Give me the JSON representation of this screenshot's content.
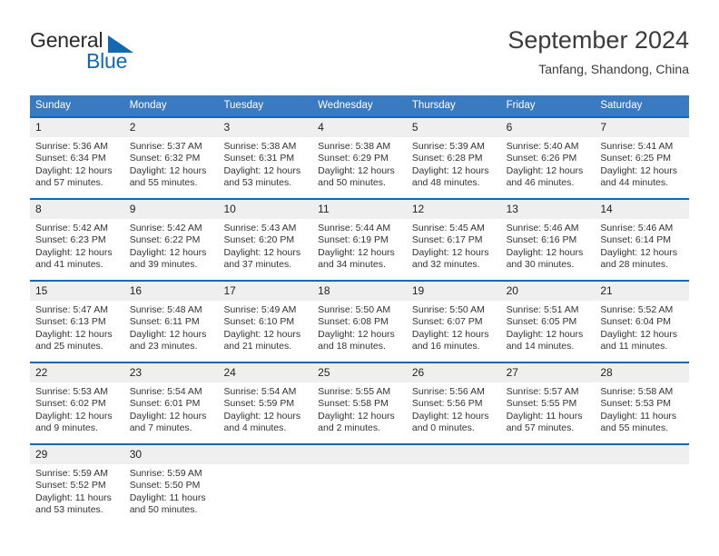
{
  "brand": {
    "name_top": "General",
    "name_bottom": "Blue",
    "triangle_color": "#1268b3"
  },
  "header": {
    "title": "September 2024",
    "subtitle": "Tanfang, Shandong, China",
    "accent_color": "#3a7ac0",
    "separator_color": "#1268b3",
    "daynum_background": "#efefef"
  },
  "weekdays": [
    "Sunday",
    "Monday",
    "Tuesday",
    "Wednesday",
    "Thursday",
    "Friday",
    "Saturday"
  ],
  "weeks": [
    [
      {
        "day": "1",
        "sunrise": "Sunrise: 5:36 AM",
        "sunset": "Sunset: 6:34 PM",
        "daylight1": "Daylight: 12 hours",
        "daylight2": "and 57 minutes."
      },
      {
        "day": "2",
        "sunrise": "Sunrise: 5:37 AM",
        "sunset": "Sunset: 6:32 PM",
        "daylight1": "Daylight: 12 hours",
        "daylight2": "and 55 minutes."
      },
      {
        "day": "3",
        "sunrise": "Sunrise: 5:38 AM",
        "sunset": "Sunset: 6:31 PM",
        "daylight1": "Daylight: 12 hours",
        "daylight2": "and 53 minutes."
      },
      {
        "day": "4",
        "sunrise": "Sunrise: 5:38 AM",
        "sunset": "Sunset: 6:29 PM",
        "daylight1": "Daylight: 12 hours",
        "daylight2": "and 50 minutes."
      },
      {
        "day": "5",
        "sunrise": "Sunrise: 5:39 AM",
        "sunset": "Sunset: 6:28 PM",
        "daylight1": "Daylight: 12 hours",
        "daylight2": "and 48 minutes."
      },
      {
        "day": "6",
        "sunrise": "Sunrise: 5:40 AM",
        "sunset": "Sunset: 6:26 PM",
        "daylight1": "Daylight: 12 hours",
        "daylight2": "and 46 minutes."
      },
      {
        "day": "7",
        "sunrise": "Sunrise: 5:41 AM",
        "sunset": "Sunset: 6:25 PM",
        "daylight1": "Daylight: 12 hours",
        "daylight2": "and 44 minutes."
      }
    ],
    [
      {
        "day": "8",
        "sunrise": "Sunrise: 5:42 AM",
        "sunset": "Sunset: 6:23 PM",
        "daylight1": "Daylight: 12 hours",
        "daylight2": "and 41 minutes."
      },
      {
        "day": "9",
        "sunrise": "Sunrise: 5:42 AM",
        "sunset": "Sunset: 6:22 PM",
        "daylight1": "Daylight: 12 hours",
        "daylight2": "and 39 minutes."
      },
      {
        "day": "10",
        "sunrise": "Sunrise: 5:43 AM",
        "sunset": "Sunset: 6:20 PM",
        "daylight1": "Daylight: 12 hours",
        "daylight2": "and 37 minutes."
      },
      {
        "day": "11",
        "sunrise": "Sunrise: 5:44 AM",
        "sunset": "Sunset: 6:19 PM",
        "daylight1": "Daylight: 12 hours",
        "daylight2": "and 34 minutes."
      },
      {
        "day": "12",
        "sunrise": "Sunrise: 5:45 AM",
        "sunset": "Sunset: 6:17 PM",
        "daylight1": "Daylight: 12 hours",
        "daylight2": "and 32 minutes."
      },
      {
        "day": "13",
        "sunrise": "Sunrise: 5:46 AM",
        "sunset": "Sunset: 6:16 PM",
        "daylight1": "Daylight: 12 hours",
        "daylight2": "and 30 minutes."
      },
      {
        "day": "14",
        "sunrise": "Sunrise: 5:46 AM",
        "sunset": "Sunset: 6:14 PM",
        "daylight1": "Daylight: 12 hours",
        "daylight2": "and 28 minutes."
      }
    ],
    [
      {
        "day": "15",
        "sunrise": "Sunrise: 5:47 AM",
        "sunset": "Sunset: 6:13 PM",
        "daylight1": "Daylight: 12 hours",
        "daylight2": "and 25 minutes."
      },
      {
        "day": "16",
        "sunrise": "Sunrise: 5:48 AM",
        "sunset": "Sunset: 6:11 PM",
        "daylight1": "Daylight: 12 hours",
        "daylight2": "and 23 minutes."
      },
      {
        "day": "17",
        "sunrise": "Sunrise: 5:49 AM",
        "sunset": "Sunset: 6:10 PM",
        "daylight1": "Daylight: 12 hours",
        "daylight2": "and 21 minutes."
      },
      {
        "day": "18",
        "sunrise": "Sunrise: 5:50 AM",
        "sunset": "Sunset: 6:08 PM",
        "daylight1": "Daylight: 12 hours",
        "daylight2": "and 18 minutes."
      },
      {
        "day": "19",
        "sunrise": "Sunrise: 5:50 AM",
        "sunset": "Sunset: 6:07 PM",
        "daylight1": "Daylight: 12 hours",
        "daylight2": "and 16 minutes."
      },
      {
        "day": "20",
        "sunrise": "Sunrise: 5:51 AM",
        "sunset": "Sunset: 6:05 PM",
        "daylight1": "Daylight: 12 hours",
        "daylight2": "and 14 minutes."
      },
      {
        "day": "21",
        "sunrise": "Sunrise: 5:52 AM",
        "sunset": "Sunset: 6:04 PM",
        "daylight1": "Daylight: 12 hours",
        "daylight2": "and 11 minutes."
      }
    ],
    [
      {
        "day": "22",
        "sunrise": "Sunrise: 5:53 AM",
        "sunset": "Sunset: 6:02 PM",
        "daylight1": "Daylight: 12 hours",
        "daylight2": "and 9 minutes."
      },
      {
        "day": "23",
        "sunrise": "Sunrise: 5:54 AM",
        "sunset": "Sunset: 6:01 PM",
        "daylight1": "Daylight: 12 hours",
        "daylight2": "and 7 minutes."
      },
      {
        "day": "24",
        "sunrise": "Sunrise: 5:54 AM",
        "sunset": "Sunset: 5:59 PM",
        "daylight1": "Daylight: 12 hours",
        "daylight2": "and 4 minutes."
      },
      {
        "day": "25",
        "sunrise": "Sunrise: 5:55 AM",
        "sunset": "Sunset: 5:58 PM",
        "daylight1": "Daylight: 12 hours",
        "daylight2": "and 2 minutes."
      },
      {
        "day": "26",
        "sunrise": "Sunrise: 5:56 AM",
        "sunset": "Sunset: 5:56 PM",
        "daylight1": "Daylight: 12 hours",
        "daylight2": "and 0 minutes."
      },
      {
        "day": "27",
        "sunrise": "Sunrise: 5:57 AM",
        "sunset": "Sunset: 5:55 PM",
        "daylight1": "Daylight: 11 hours",
        "daylight2": "and 57 minutes."
      },
      {
        "day": "28",
        "sunrise": "Sunrise: 5:58 AM",
        "sunset": "Sunset: 5:53 PM",
        "daylight1": "Daylight: 11 hours",
        "daylight2": "and 55 minutes."
      }
    ],
    [
      {
        "day": "29",
        "sunrise": "Sunrise: 5:59 AM",
        "sunset": "Sunset: 5:52 PM",
        "daylight1": "Daylight: 11 hours",
        "daylight2": "and 53 minutes."
      },
      {
        "day": "30",
        "sunrise": "Sunrise: 5:59 AM",
        "sunset": "Sunset: 5:50 PM",
        "daylight1": "Daylight: 11 hours",
        "daylight2": "and 50 minutes."
      },
      {
        "day": "",
        "sunrise": "",
        "sunset": "",
        "daylight1": "",
        "daylight2": ""
      },
      {
        "day": "",
        "sunrise": "",
        "sunset": "",
        "daylight1": "",
        "daylight2": ""
      },
      {
        "day": "",
        "sunrise": "",
        "sunset": "",
        "daylight1": "",
        "daylight2": ""
      },
      {
        "day": "",
        "sunrise": "",
        "sunset": "",
        "daylight1": "",
        "daylight2": ""
      },
      {
        "day": "",
        "sunrise": "",
        "sunset": "",
        "daylight1": "",
        "daylight2": ""
      }
    ]
  ]
}
